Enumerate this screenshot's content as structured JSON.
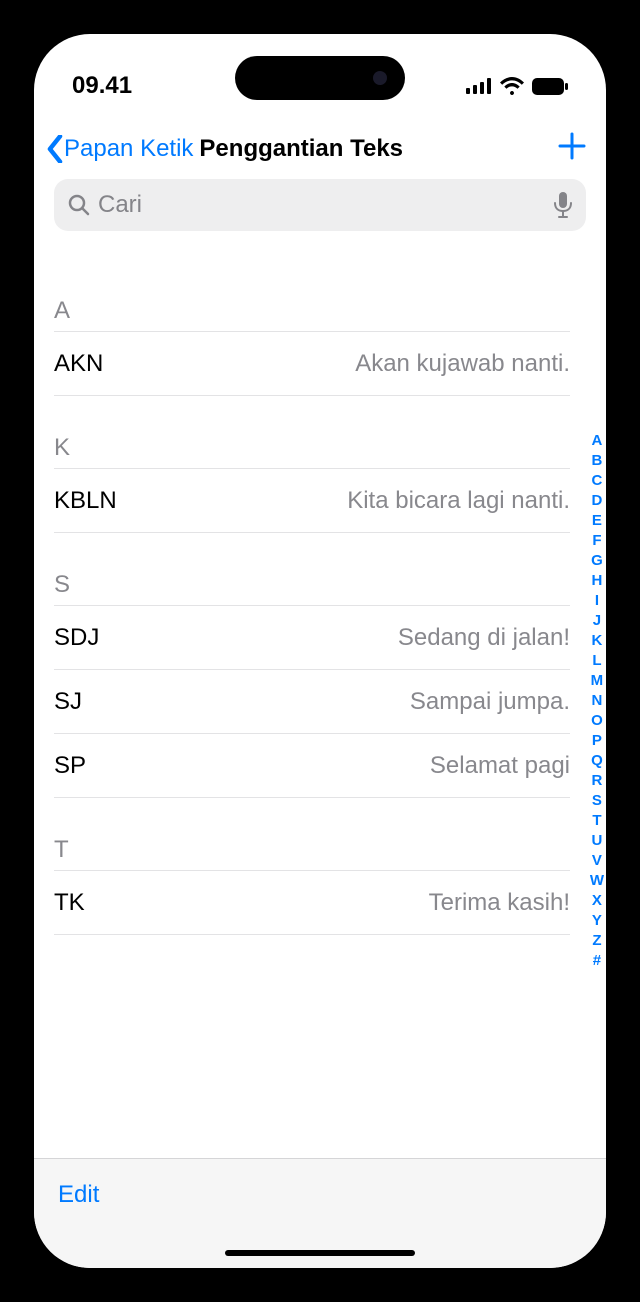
{
  "status": {
    "time": "09.41"
  },
  "nav": {
    "back_label": "Papan Ketik",
    "title": "Penggantian Teks"
  },
  "search": {
    "placeholder": "Cari"
  },
  "sections": [
    {
      "letter": "A",
      "items": [
        {
          "shortcut": "AKN",
          "phrase": "Akan kujawab nanti."
        }
      ]
    },
    {
      "letter": "K",
      "items": [
        {
          "shortcut": "KBLN",
          "phrase": "Kita bicara lagi nanti."
        }
      ]
    },
    {
      "letter": "S",
      "items": [
        {
          "shortcut": "SDJ",
          "phrase": "Sedang di jalan!"
        },
        {
          "shortcut": "SJ",
          "phrase": "Sampai jumpa."
        },
        {
          "shortcut": "SP",
          "phrase": "Selamat pagi"
        }
      ]
    },
    {
      "letter": "T",
      "items": [
        {
          "shortcut": "TK",
          "phrase": "Terima kasih!"
        }
      ]
    }
  ],
  "index_letters": [
    "A",
    "B",
    "C",
    "D",
    "E",
    "F",
    "G",
    "H",
    "I",
    "J",
    "K",
    "L",
    "M",
    "N",
    "O",
    "P",
    "Q",
    "R",
    "S",
    "T",
    "U",
    "V",
    "W",
    "X",
    "Y",
    "Z",
    "#"
  ],
  "toolbar": {
    "edit_label": "Edit"
  }
}
